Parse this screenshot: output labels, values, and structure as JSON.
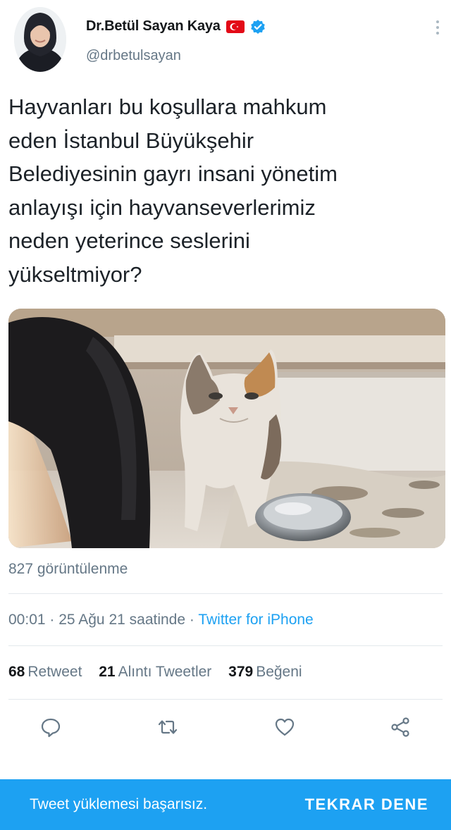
{
  "tweet": {
    "display_name": "Dr.Betül Sayan Kaya",
    "handle": "@drbetulsayan",
    "text_lines": [
      "Hayvanları bu koşullara mahkum",
      "eden İstanbul Büyükşehir",
      "Belediyesinin gayrı insani yönetim",
      "anlayışı için hayvanseverlerimiz",
      "neden yeterince seslerini",
      "yükseltmiyor?"
    ],
    "views": "827 görüntülenme",
    "timestamp": "00:01 · 25 Ağu 21 saatinde · ",
    "source": "Twitter for iPhone",
    "stats": {
      "retweets": "68",
      "retweets_label": "Retweet",
      "quotes": "21",
      "quotes_label": "Alıntı Tweetler",
      "likes": "379",
      "likes_label": "Beğeni"
    }
  },
  "icons": {
    "flag": "turkey-flag-icon",
    "verified": "verified-badge-icon",
    "more": "more-vertical-icon",
    "reply": "reply-icon",
    "retweet": "retweet-icon",
    "like": "heart-icon",
    "share": "share-icon"
  },
  "colors": {
    "accent": "#1da1f2",
    "secondary_text": "#657786",
    "primary_text": "#14171a",
    "flag_red": "#e30a17"
  },
  "snackbar": {
    "message": "Tweet yüklemesi başarısız.",
    "action": "TEKRAR DENE"
  }
}
